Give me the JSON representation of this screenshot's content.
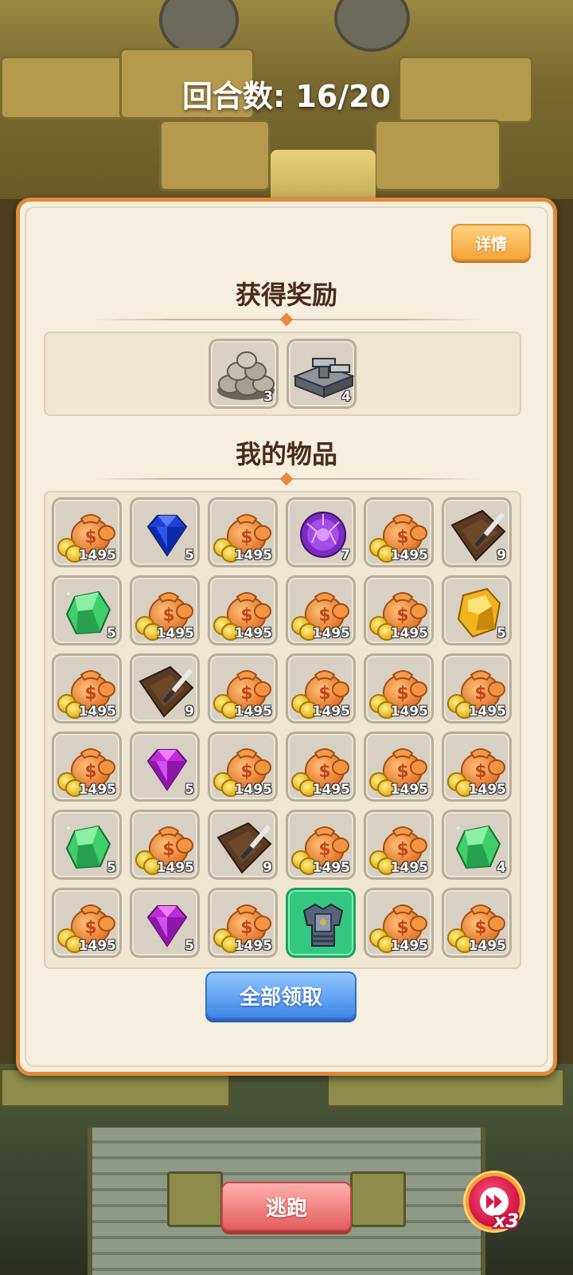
{
  "hud": {
    "round_counter": "回合数: 16/20"
  },
  "panel": {
    "details_label": "详情",
    "rewards_title": "获得奖励",
    "items_title": "我的物品",
    "claim_all_label": "全部领取"
  },
  "rewards": [
    {
      "icon": "stone-pile-icon",
      "count": "3"
    },
    {
      "icon": "iron-ingot-icon",
      "count": "4"
    }
  ],
  "items": [
    {
      "icon": "money-bag-icon",
      "count": "1495"
    },
    {
      "icon": "blue-gem-icon",
      "count": "5"
    },
    {
      "icon": "money-bag-icon",
      "count": "1495"
    },
    {
      "icon": "purple-orb-icon",
      "count": "7"
    },
    {
      "icon": "money-bag-icon",
      "count": "1495"
    },
    {
      "icon": "leather-knife-icon",
      "count": "9"
    },
    {
      "icon": "green-crystal-icon",
      "count": "5"
    },
    {
      "icon": "money-bag-icon",
      "count": "1495"
    },
    {
      "icon": "money-bag-icon",
      "count": "1495"
    },
    {
      "icon": "money-bag-icon",
      "count": "1495"
    },
    {
      "icon": "money-bag-icon",
      "count": "1495"
    },
    {
      "icon": "gold-ore-icon",
      "count": "5"
    },
    {
      "icon": "money-bag-icon",
      "count": "1495"
    },
    {
      "icon": "leather-knife-icon",
      "count": "9"
    },
    {
      "icon": "money-bag-icon",
      "count": "1495"
    },
    {
      "icon": "money-bag-icon",
      "count": "1495"
    },
    {
      "icon": "money-bag-icon",
      "count": "1495"
    },
    {
      "icon": "money-bag-icon",
      "count": "1495"
    },
    {
      "icon": "money-bag-icon",
      "count": "1495"
    },
    {
      "icon": "purple-gem-icon",
      "count": "5"
    },
    {
      "icon": "money-bag-icon",
      "count": "1495"
    },
    {
      "icon": "money-bag-icon",
      "count": "1495"
    },
    {
      "icon": "money-bag-icon",
      "count": "1495"
    },
    {
      "icon": "money-bag-icon",
      "count": "1495"
    },
    {
      "icon": "green-crystal-icon",
      "count": "5"
    },
    {
      "icon": "money-bag-icon",
      "count": "1495"
    },
    {
      "icon": "leather-knife-icon",
      "count": "9"
    },
    {
      "icon": "money-bag-icon",
      "count": "1495"
    },
    {
      "icon": "money-bag-icon",
      "count": "1495"
    },
    {
      "icon": "green-crystal-icon",
      "count": "4"
    },
    {
      "icon": "money-bag-icon",
      "count": "1495"
    },
    {
      "icon": "purple-gem-icon",
      "count": "5"
    },
    {
      "icon": "money-bag-icon",
      "count": "1495"
    },
    {
      "icon": "armor-icon",
      "count": "",
      "rarity": "green"
    },
    {
      "icon": "money-bag-icon",
      "count": "1495"
    },
    {
      "icon": "money-bag-icon",
      "count": "1495"
    }
  ],
  "controls": {
    "flee_label": "逃跑",
    "speed_label": "x3"
  },
  "colors": {
    "panel_border": "#e08a3c",
    "claim_button": "#3f86e6",
    "flee_button": "#e35e5e",
    "details_button": "#f4a43c"
  }
}
